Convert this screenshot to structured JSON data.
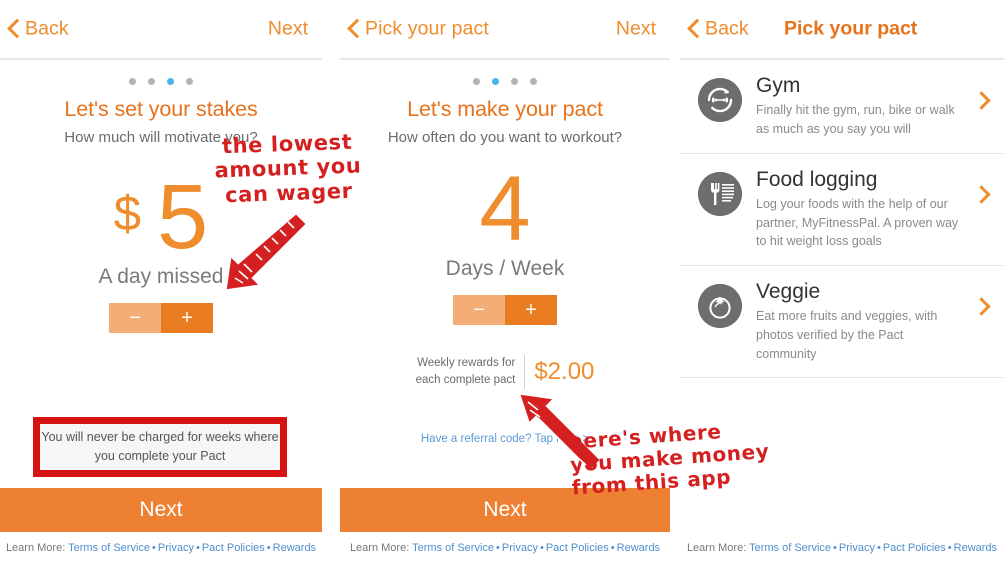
{
  "panel1": {
    "nav": {
      "back_label": "Back",
      "next_label": "Next"
    },
    "dots": {
      "count": 4,
      "active_index": 2
    },
    "title": "Let's set your stakes",
    "subtitle": "How much will motivate you?",
    "currency_symbol": "$",
    "value": "5",
    "value_caption": "A day missed",
    "stepper": {
      "minus": "−",
      "plus": "+"
    },
    "callout": "You will never be charged for weeks where you complete your Pact",
    "next_button": "Next",
    "footer": {
      "lead": "Learn More:",
      "links": [
        "Terms of Service",
        "Privacy",
        "Pact Policies",
        "Rewards"
      ],
      "separator": "•"
    }
  },
  "panel2": {
    "nav": {
      "back_label": "Pick your pact",
      "next_label": "Next"
    },
    "dots": {
      "count": 4,
      "active_index": 1
    },
    "title": "Let's make your pact",
    "subtitle": "How often do you want to workout?",
    "value": "4",
    "value_caption": "Days / Week",
    "stepper": {
      "minus": "−",
      "plus": "+"
    },
    "rewards_label_line1": "Weekly rewards for",
    "rewards_label_line2": "each complete pact",
    "rewards_amount": "$2.00",
    "referral_link": "Have a referral code? Tap here >",
    "next_button": "Next",
    "footer": {
      "lead": "Learn More:",
      "links": [
        "Terms of Service",
        "Privacy",
        "Pact Policies",
        "Rewards"
      ],
      "separator": "•"
    }
  },
  "panel3": {
    "nav": {
      "back_label": "Back",
      "title": "Pick your pact"
    },
    "items": [
      {
        "icon": "dumbbell-icon",
        "title": "Gym",
        "desc": "Finally hit the gym, run, bike or walk as much as you say you will"
      },
      {
        "icon": "fork-and-menu-icon",
        "title": "Food logging",
        "desc": "Log your foods with the help of our partner, MyFitnessPal. A proven way to hit weight loss goals"
      },
      {
        "icon": "tomato-icon",
        "title": "Veggie",
        "desc": "Eat more fruits and veggies, with photos verified by the Pact community"
      }
    ],
    "footer": {
      "lead": "Learn More:",
      "links": [
        "Terms of Service",
        "Privacy",
        "Pact Policies",
        "Rewards"
      ],
      "separator": "•"
    }
  },
  "annotations": [
    {
      "text": "the lowest\namount you\ncan wager",
      "arrow": "arrow-down-left"
    },
    {
      "text": "here's where\nyou make money\nfrom this app",
      "arrow": "arrow-up-left"
    }
  ],
  "colors": {
    "orange": "#ef8c2c",
    "orange_dark": "#e8721c",
    "orange_button": "#ee8034",
    "blue_dot": "#45b4e8",
    "link_blue": "#4f8fd0",
    "annotation_red": "#d42020",
    "callout_red": "#d61313",
    "icon_gray": "#6d6d6d"
  }
}
